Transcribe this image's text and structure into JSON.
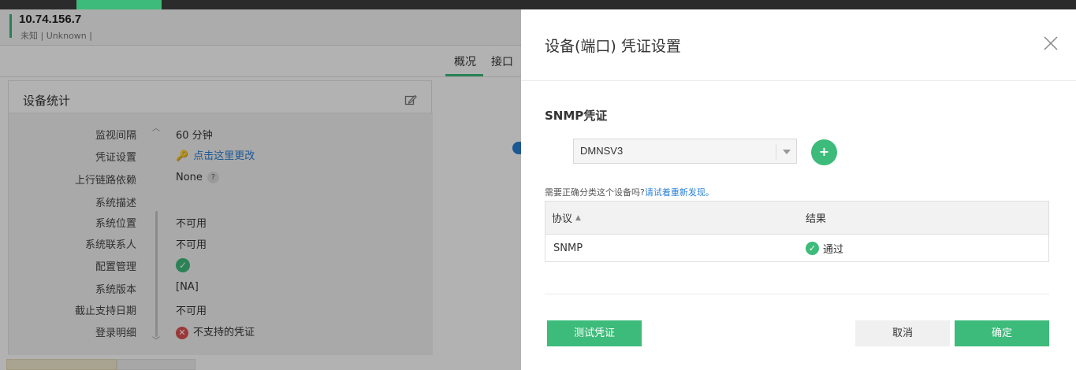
{
  "device": {
    "ip": "10.74.156.7",
    "subtitle": "未知 | Unknown |"
  },
  "tabs": {
    "overview": "概况",
    "interface": "接口"
  },
  "stats": {
    "title": "设备统计",
    "rows": [
      {
        "label": "监视间隔",
        "value": "60 分钟"
      },
      {
        "label": "凭证设置",
        "value": "点击这里更改"
      },
      {
        "label": "上行链路依赖",
        "value": "None"
      },
      {
        "label": "系统描述",
        "value": ""
      },
      {
        "label": "系统位置",
        "value": "不可用"
      },
      {
        "label": "系统联系人",
        "value": "不可用"
      },
      {
        "label": "配置管理",
        "value": ""
      },
      {
        "label": "系统版本",
        "value": "[NA]"
      },
      {
        "label": "截止支持日期",
        "value": "不可用"
      },
      {
        "label": "登录明细",
        "value": "不支持的凭证"
      }
    ]
  },
  "modal": {
    "title": "设备(端口) 凭证设置",
    "section_title": "SNMP凭证",
    "credential_select_value": "DMNSV3",
    "add_label": "+",
    "note_prefix": "需要正确分类这个设备吗?",
    "note_link": "请试着重新发现。",
    "table": {
      "headers": [
        "协议",
        "结果"
      ],
      "rows": [
        {
          "protocol": "SNMP",
          "result": "通过"
        }
      ]
    },
    "buttons": {
      "test": "测试凭证",
      "cancel": "取消",
      "ok": "确定"
    }
  },
  "colors": {
    "accent": "#3dbb7a",
    "link": "#2a7fd4",
    "error": "#e05050"
  }
}
